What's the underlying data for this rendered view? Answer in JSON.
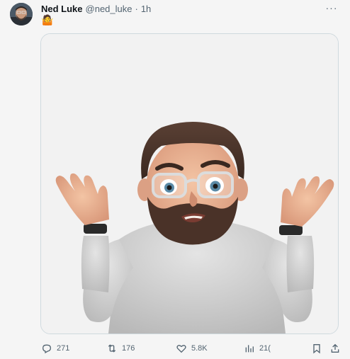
{
  "tweet": {
    "author_name": "Ned Luke",
    "handle": "@ned_luke",
    "separator": "·",
    "time": "1h",
    "status_emoji": "🤷",
    "more_label": "···"
  },
  "actions": {
    "replies": "271",
    "retweets": "176",
    "likes": "5.8K",
    "views": "21("
  },
  "colors": {
    "muted": "#536471",
    "border": "#cfd9de",
    "text": "#0f1419"
  },
  "icons": [
    "reply-icon",
    "retweet-icon",
    "like-icon",
    "views-icon",
    "bookmark-icon",
    "share-icon",
    "more-icon"
  ]
}
